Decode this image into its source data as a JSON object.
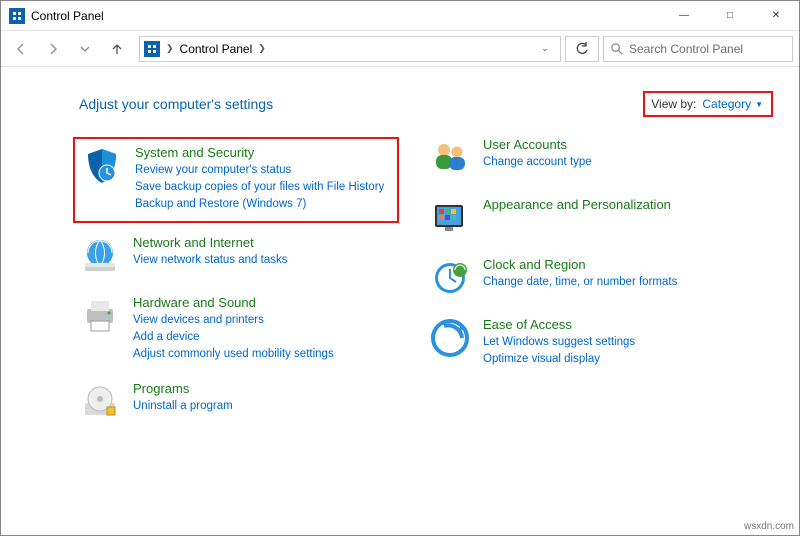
{
  "window": {
    "title": "Control Panel"
  },
  "breadcrumb": {
    "root": "Control Panel"
  },
  "search": {
    "placeholder": "Search Control Panel"
  },
  "heading": "Adjust your computer's settings",
  "viewby": {
    "label": "View by:",
    "value": "Category"
  },
  "left": {
    "system": {
      "title": "System and Security",
      "links": [
        "Review your computer's status",
        "Save backup copies of your files with File History",
        "Backup and Restore (Windows 7)"
      ]
    },
    "network": {
      "title": "Network and Internet",
      "links": [
        "View network status and tasks"
      ]
    },
    "hardware": {
      "title": "Hardware and Sound",
      "links": [
        "View devices and printers",
        "Add a device",
        "Adjust commonly used mobility settings"
      ]
    },
    "programs": {
      "title": "Programs",
      "links": [
        "Uninstall a program"
      ]
    }
  },
  "right": {
    "users": {
      "title": "User Accounts",
      "links": [
        "Change account type"
      ]
    },
    "appearance": {
      "title": "Appearance and Personalization",
      "links": []
    },
    "clock": {
      "title": "Clock and Region",
      "links": [
        "Change date, time, or number formats"
      ]
    },
    "ease": {
      "title": "Ease of Access",
      "links": [
        "Let Windows suggest settings",
        "Optimize visual display"
      ]
    }
  },
  "watermark": "wsxdn.com"
}
